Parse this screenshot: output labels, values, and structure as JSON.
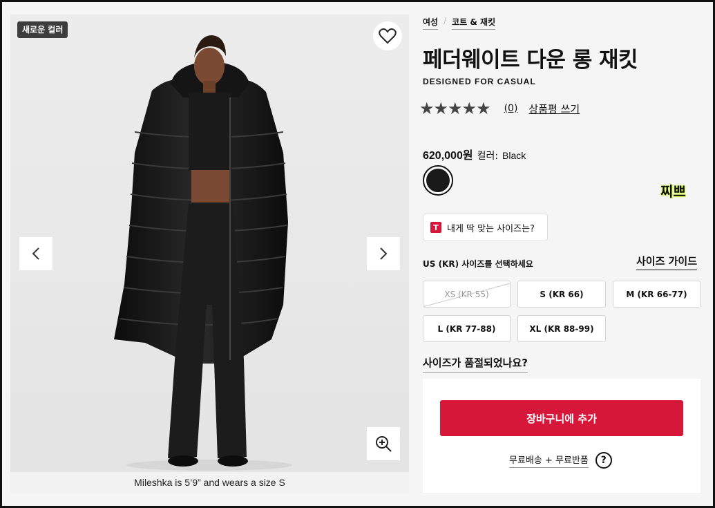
{
  "gallery": {
    "badge": "새로운 컬러",
    "caption": "Mileshka is 5’9” and wears a size S",
    "icons": [
      "heart-icon",
      "chevron-left-icon",
      "chevron-right-icon",
      "zoom-in-icon"
    ]
  },
  "breadcrumb": [
    "여성",
    "코트 & 재킷"
  ],
  "product": {
    "title": "페더웨이트 다운 롱 재킷",
    "subtitle": "DESIGNED FOR CASUAL",
    "stars": "★★★★★",
    "rating_count": "(0)",
    "write_review": "상품평 쓰기",
    "price": "620,000원",
    "color_label": "컬러:",
    "color_value": "Black",
    "swatch_color": "#1a1a1a",
    "sticker": "찌쁘"
  },
  "fit": {
    "logo": "T",
    "label": "내게 딱 맞는 사이즈는?"
  },
  "sizes": {
    "prompt": "US (KR) 사이즈를 선택하세요",
    "guide": "사이즈 가이드",
    "options": [
      {
        "label": "XS (KR 55)",
        "available": false
      },
      {
        "label": "S (KR 66)",
        "available": true
      },
      {
        "label": "M (KR 66-77)",
        "available": true
      },
      {
        "label": "L (KR 77-88)",
        "available": true
      },
      {
        "label": "XL (KR 88-99)",
        "available": true
      }
    ],
    "sold_out_question": "사이즈가 품절되었나요?"
  },
  "cart": {
    "add_label": "장바구니에 추가",
    "shipping": "무료배송 + 무료반품",
    "help": "?",
    "accent": "#d6173a"
  }
}
